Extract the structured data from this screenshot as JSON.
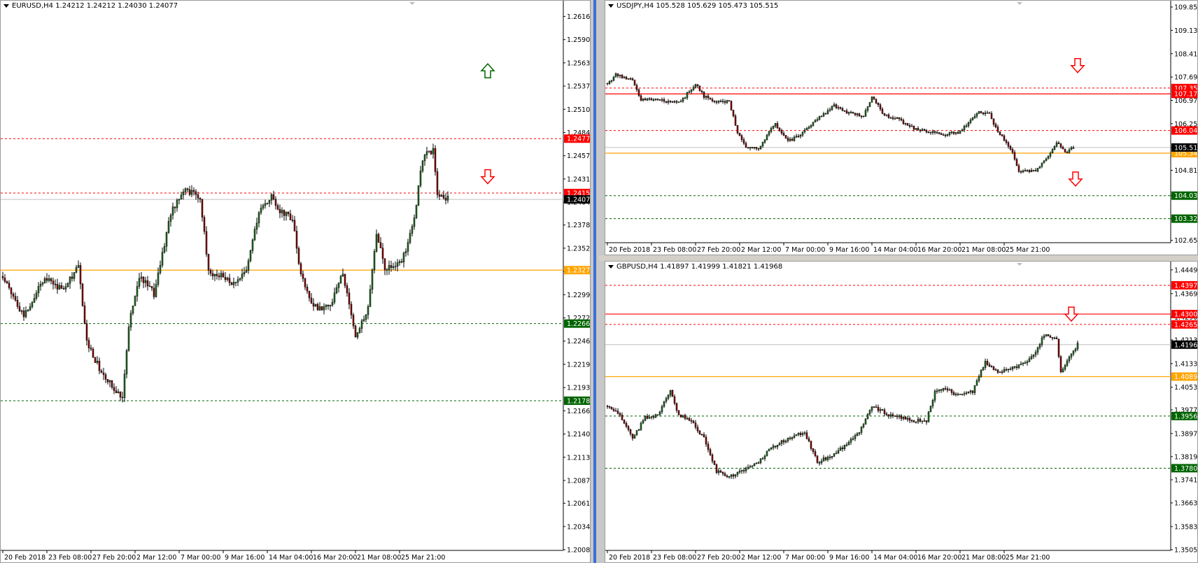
{
  "colors": {
    "bull": "#1f6f1f",
    "bear": "#8b0000",
    "wick": "#000000",
    "resistance": "#ff0000",
    "support": "#006400",
    "pivot": "#ffa500",
    "arrow_down": "#ff0000",
    "arrow_up": "#006400",
    "current": "#000000"
  },
  "chart_data": [
    {
      "type": "candlestick",
      "symbol": "EURUSD",
      "title": "EURUSD,H4  1.24212 1.24212 1.24030 1.24077",
      "ylim": [
        1.2008,
        1.2632
      ],
      "x_range": [
        0,
        212
      ],
      "yticks": [
        "1.26165",
        "1.25900",
        "1.25635",
        "1.25370",
        "1.25105",
        "1.24840",
        "1.24575",
        "1.24310",
        "1.24045",
        "1.23785",
        "1.23520",
        "1.23255",
        "1.22990",
        "1.22725",
        "1.22460",
        "1.22195",
        "1.21930",
        "1.21665",
        "1.21400",
        "1.21135",
        "1.20870",
        "1.20610",
        "1.20345",
        "1.20080"
      ],
      "xticks": [
        {
          "i": 0,
          "label": "20 Feb 2018"
        },
        {
          "i": 21,
          "label": "23 Feb 08:00"
        },
        {
          "i": 42,
          "label": "27 Feb 20:00"
        },
        {
          "i": 63,
          "label": "2 Mar 12:00"
        },
        {
          "i": 84,
          "label": "7 Mar 00:00"
        },
        {
          "i": 105,
          "label": "9 Mar 16:00"
        },
        {
          "i": 126,
          "label": "14 Mar 04:00"
        },
        {
          "i": 147,
          "label": "16 Mar 20:00"
        },
        {
          "i": 168,
          "label": "21 Mar 08:00"
        },
        {
          "i": 189,
          "label": "25 Mar 21:00"
        }
      ],
      "levels": [
        {
          "price": 1.2477,
          "label": "1.24770",
          "style": "dashed",
          "color": "#ff0000"
        },
        {
          "price": 1.2415,
          "label": "1.24150",
          "style": "dashed",
          "color": "#ff0000"
        },
        {
          "price": 1.2327,
          "label": "1.23270",
          "style": "solid",
          "color": "#ffa500"
        },
        {
          "price": 1.2266,
          "label": "1.22660",
          "style": "dashed",
          "color": "#006400"
        },
        {
          "price": 1.2178,
          "label": "1.21780",
          "style": "dashed",
          "color": "#006400"
        }
      ],
      "current_price": {
        "price": 1.24077,
        "label": "1.24077"
      },
      "arrows": [
        {
          "dir": "up",
          "i": 231,
          "price": 1.2556
        },
        {
          "dir": "down",
          "i": 231,
          "price": 1.2432
        }
      ],
      "anchors": [
        [
          0,
          1.232
        ],
        [
          10,
          1.2275
        ],
        [
          20,
          1.232
        ],
        [
          28,
          1.2305
        ],
        [
          36,
          1.233
        ],
        [
          40,
          1.2245
        ],
        [
          48,
          1.2205
        ],
        [
          57,
          1.2183
        ],
        [
          60,
          1.2265
        ],
        [
          65,
          1.232
        ],
        [
          72,
          1.23
        ],
        [
          80,
          1.2392
        ],
        [
          86,
          1.242
        ],
        [
          94,
          1.241
        ],
        [
          98,
          1.2325
        ],
        [
          104,
          1.232
        ],
        [
          110,
          1.231
        ],
        [
          116,
          1.2325
        ],
        [
          122,
          1.2395
        ],
        [
          128,
          1.241
        ],
        [
          132,
          1.2395
        ],
        [
          138,
          1.2385
        ],
        [
          142,
          1.232
        ],
        [
          148,
          1.2285
        ],
        [
          156,
          1.2285
        ],
        [
          162,
          1.2325
        ],
        [
          168,
          1.225
        ],
        [
          174,
          1.2285
        ],
        [
          178,
          1.237
        ],
        [
          182,
          1.233
        ],
        [
          190,
          1.2335
        ],
        [
          196,
          1.2385
        ],
        [
          200,
          1.2455
        ],
        [
          205,
          1.2465
        ],
        [
          207,
          1.241
        ],
        [
          212,
          1.2408
        ]
      ]
    },
    {
      "type": "candlestick",
      "symbol": "USDJPY",
      "title": "USDJPY,H4  105.528 105.629 105.473 105.515",
      "ylim": [
        102.6,
        109.98
      ],
      "x_range": [
        0,
        212
      ],
      "yticks": [
        "109.850",
        "109.130",
        "108.410",
        "107.690",
        "106.970",
        "106.250",
        "105.515",
        "104.810",
        "104.030",
        "103.320",
        "102.650"
      ],
      "xticks": [
        {
          "i": 0,
          "label": "20 Feb 2018"
        },
        {
          "i": 21,
          "label": "23 Feb 08:00"
        },
        {
          "i": 42,
          "label": "27 Feb 20:00"
        },
        {
          "i": 63,
          "label": "2 Mar 12:00"
        },
        {
          "i": 84,
          "label": "7 Mar 00:00"
        },
        {
          "i": 105,
          "label": "9 Mar 16:00"
        },
        {
          "i": 126,
          "label": "14 Mar 04:00"
        },
        {
          "i": 147,
          "label": "16 Mar 20:00"
        },
        {
          "i": 168,
          "label": "21 Mar 08:00"
        },
        {
          "i": 189,
          "label": "25 Mar 21:00"
        }
      ],
      "levels": [
        {
          "price": 107.35,
          "label": "107.350",
          "style": "dashed",
          "color": "#ff0000"
        },
        {
          "price": 107.17,
          "label": "107.170",
          "style": "solid",
          "color": "#ff0000"
        },
        {
          "price": 106.04,
          "label": "106.040",
          "style": "dashed",
          "color": "#ff0000"
        },
        {
          "price": 105.34,
          "label": "105.340",
          "style": "solid",
          "color": "#ffa500"
        },
        {
          "price": 104.03,
          "label": "104.030",
          "style": "dashed",
          "color": "#006400"
        },
        {
          "price": 103.32,
          "label": "103.320",
          "style": "dashed",
          "color": "#006400"
        }
      ],
      "current_price": {
        "price": 105.515,
        "label": "105.515"
      },
      "arrows": [
        {
          "dir": "down",
          "i": 224,
          "price": 108.0
        },
        {
          "dir": "down",
          "i": 223,
          "price": 104.5
        }
      ],
      "anchors": [
        [
          0,
          107.5
        ],
        [
          4,
          107.75
        ],
        [
          12,
          107.6
        ],
        [
          16,
          107.0
        ],
        [
          24,
          107.0
        ],
        [
          30,
          106.9
        ],
        [
          36,
          107.0
        ],
        [
          42,
          107.5
        ],
        [
          46,
          107.1
        ],
        [
          52,
          106.9
        ],
        [
          58,
          106.95
        ],
        [
          62,
          106.0
        ],
        [
          66,
          105.5
        ],
        [
          72,
          105.5
        ],
        [
          80,
          106.25
        ],
        [
          86,
          105.7
        ],
        [
          92,
          105.9
        ],
        [
          100,
          106.4
        ],
        [
          108,
          106.8
        ],
        [
          114,
          106.6
        ],
        [
          122,
          106.5
        ],
        [
          126,
          107.1
        ],
        [
          132,
          106.5
        ],
        [
          138,
          106.4
        ],
        [
          146,
          106.1
        ],
        [
          154,
          106.0
        ],
        [
          160,
          105.9
        ],
        [
          168,
          106.0
        ],
        [
          176,
          106.6
        ],
        [
          182,
          106.55
        ],
        [
          186,
          106.0
        ],
        [
          192,
          105.5
        ],
        [
          196,
          104.8
        ],
        [
          204,
          104.8
        ],
        [
          210,
          105.2
        ],
        [
          214,
          105.7
        ],
        [
          218,
          105.35
        ],
        [
          222,
          105.52
        ]
      ]
    },
    {
      "type": "candlestick",
      "symbol": "GBPUSD",
      "title": "GBPUSD,H4  1.41897 1.41999 1.41821 1.41968",
      "ylim": [
        1.3505,
        1.447
      ],
      "x_range": [
        0,
        212
      ],
      "yticks": [
        "1.44490",
        "1.43690",
        "1.42900",
        "1.42130",
        "1.41330",
        "1.40530",
        "1.39770",
        "1.38970",
        "1.38190",
        "1.37410",
        "1.36630",
        "1.35830",
        "1.35050"
      ],
      "xticks": [
        {
          "i": 0,
          "label": "20 Feb 2018"
        },
        {
          "i": 21,
          "label": "23 Feb 08:00"
        },
        {
          "i": 42,
          "label": "27 Feb 20:00"
        },
        {
          "i": 63,
          "label": "2 Mar 12:00"
        },
        {
          "i": 84,
          "label": "7 Mar 00:00"
        },
        {
          "i": 105,
          "label": "9 Mar 16:00"
        },
        {
          "i": 126,
          "label": "14 Mar 04:00"
        },
        {
          "i": 147,
          "label": "16 Mar 20:00"
        },
        {
          "i": 168,
          "label": "21 Mar 08:00"
        },
        {
          "i": 189,
          "label": "25 Mar 21:00"
        }
      ],
      "levels": [
        {
          "price": 1.4397,
          "label": "1.43970",
          "style": "dashed",
          "color": "#ff0000"
        },
        {
          "price": 1.43,
          "label": "1.43000",
          "style": "solid",
          "color": "#ff0000"
        },
        {
          "price": 1.4265,
          "label": "1.42650",
          "style": "dashed",
          "color": "#ff0000"
        },
        {
          "price": 1.4089,
          "label": "1.40890",
          "style": "solid",
          "color": "#ffa500"
        },
        {
          "price": 1.3956,
          "label": "1.39560",
          "style": "dashed",
          "color": "#006400"
        },
        {
          "price": 1.378,
          "label": "1.37800",
          "style": "dashed",
          "color": "#006400"
        }
      ],
      "current_price": {
        "price": 1.41968,
        "label": "1.41968"
      },
      "arrows": [
        {
          "dir": "down",
          "i": 221,
          "price": 1.4295
        }
      ],
      "anchors": [
        [
          0,
          1.399
        ],
        [
          6,
          1.396
        ],
        [
          12,
          1.388
        ],
        [
          18,
          1.395
        ],
        [
          24,
          1.396
        ],
        [
          30,
          1.404
        ],
        [
          34,
          1.396
        ],
        [
          40,
          1.394
        ],
        [
          46,
          1.388
        ],
        [
          52,
          1.377
        ],
        [
          58,
          1.375
        ],
        [
          64,
          1.377
        ],
        [
          72,
          1.38
        ],
        [
          78,
          1.385
        ],
        [
          86,
          1.388
        ],
        [
          94,
          1.39
        ],
        [
          100,
          1.38
        ],
        [
          106,
          1.382
        ],
        [
          114,
          1.386
        ],
        [
          120,
          1.39
        ],
        [
          126,
          1.399
        ],
        [
          134,
          1.396
        ],
        [
          140,
          1.395
        ],
        [
          146,
          1.394
        ],
        [
          152,
          1.394
        ],
        [
          156,
          1.404
        ],
        [
          160,
          1.405
        ],
        [
          166,
          1.403
        ],
        [
          174,
          1.404
        ],
        [
          180,
          1.414
        ],
        [
          186,
          1.41
        ],
        [
          192,
          1.412
        ],
        [
          198,
          1.413
        ],
        [
          204,
          1.417
        ],
        [
          208,
          1.423
        ],
        [
          214,
          1.422
        ],
        [
          216,
          1.41
        ],
        [
          220,
          1.415
        ],
        [
          224,
          1.4197
        ]
      ]
    }
  ]
}
